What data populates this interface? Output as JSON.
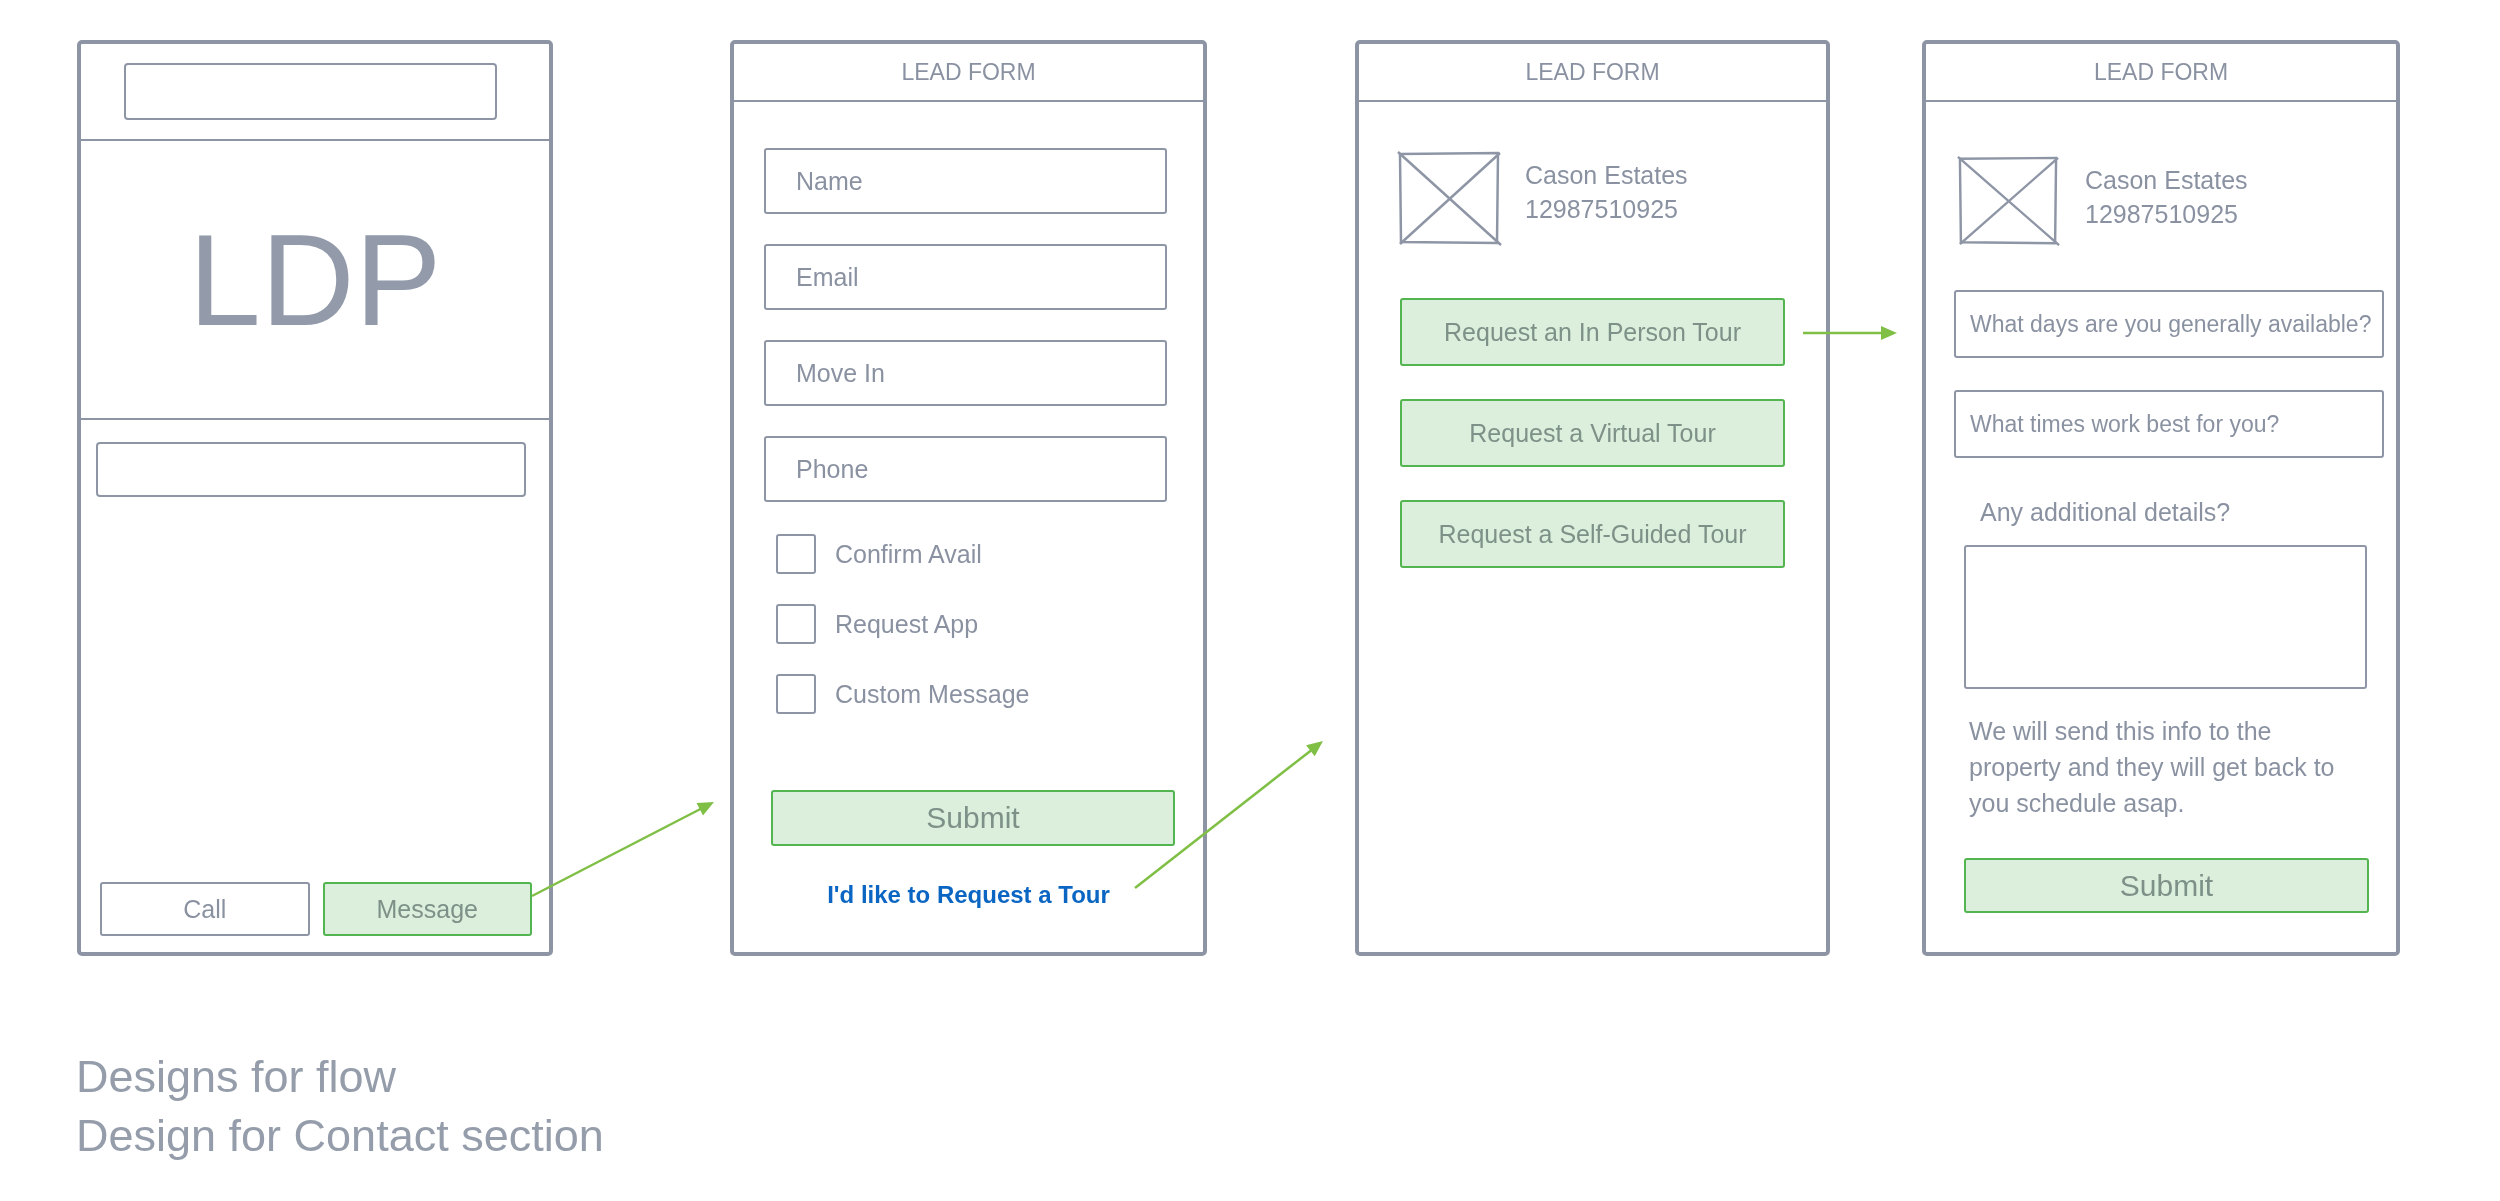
{
  "screens": [
    {
      "kind": "listing",
      "title": "LDP",
      "buttons": [
        {
          "label": "Call",
          "highlighted": false
        },
        {
          "label": "Message",
          "highlighted": true
        }
      ]
    },
    {
      "kind": "lead_form",
      "header": "LEAD FORM",
      "fields": [
        {
          "placeholder": "Name"
        },
        {
          "placeholder": "Email"
        },
        {
          "placeholder": "Move In"
        },
        {
          "placeholder": "Phone"
        }
      ],
      "checkboxes": [
        {
          "label": "Confirm Avail",
          "checked": false
        },
        {
          "label": "Request App",
          "checked": false
        },
        {
          "label": "Custom Message",
          "checked": false
        }
      ],
      "submit": "Submit",
      "link": "I'd like to Request a Tour"
    },
    {
      "kind": "tour_options",
      "header": "LEAD FORM",
      "property": {
        "name": "Cason Estates",
        "phone": "12987510925"
      },
      "options": [
        "Request an In Person Tour",
        "Request a Virtual Tour",
        "Request a Self-Guided Tour"
      ]
    },
    {
      "kind": "tour_form",
      "header": "LEAD FORM",
      "property": {
        "name": "Cason Estates",
        "phone": "12987510925"
      },
      "questions": [
        {
          "placeholder": "What days are you generally available?"
        },
        {
          "placeholder": "What times work best for you?"
        }
      ],
      "details_label": "Any additional details?",
      "note": "We will send this info to the property and they will get back to you schedule asap.",
      "submit": "Submit"
    }
  ],
  "captions": [
    "Designs for flow",
    "Design for Contact section"
  ]
}
